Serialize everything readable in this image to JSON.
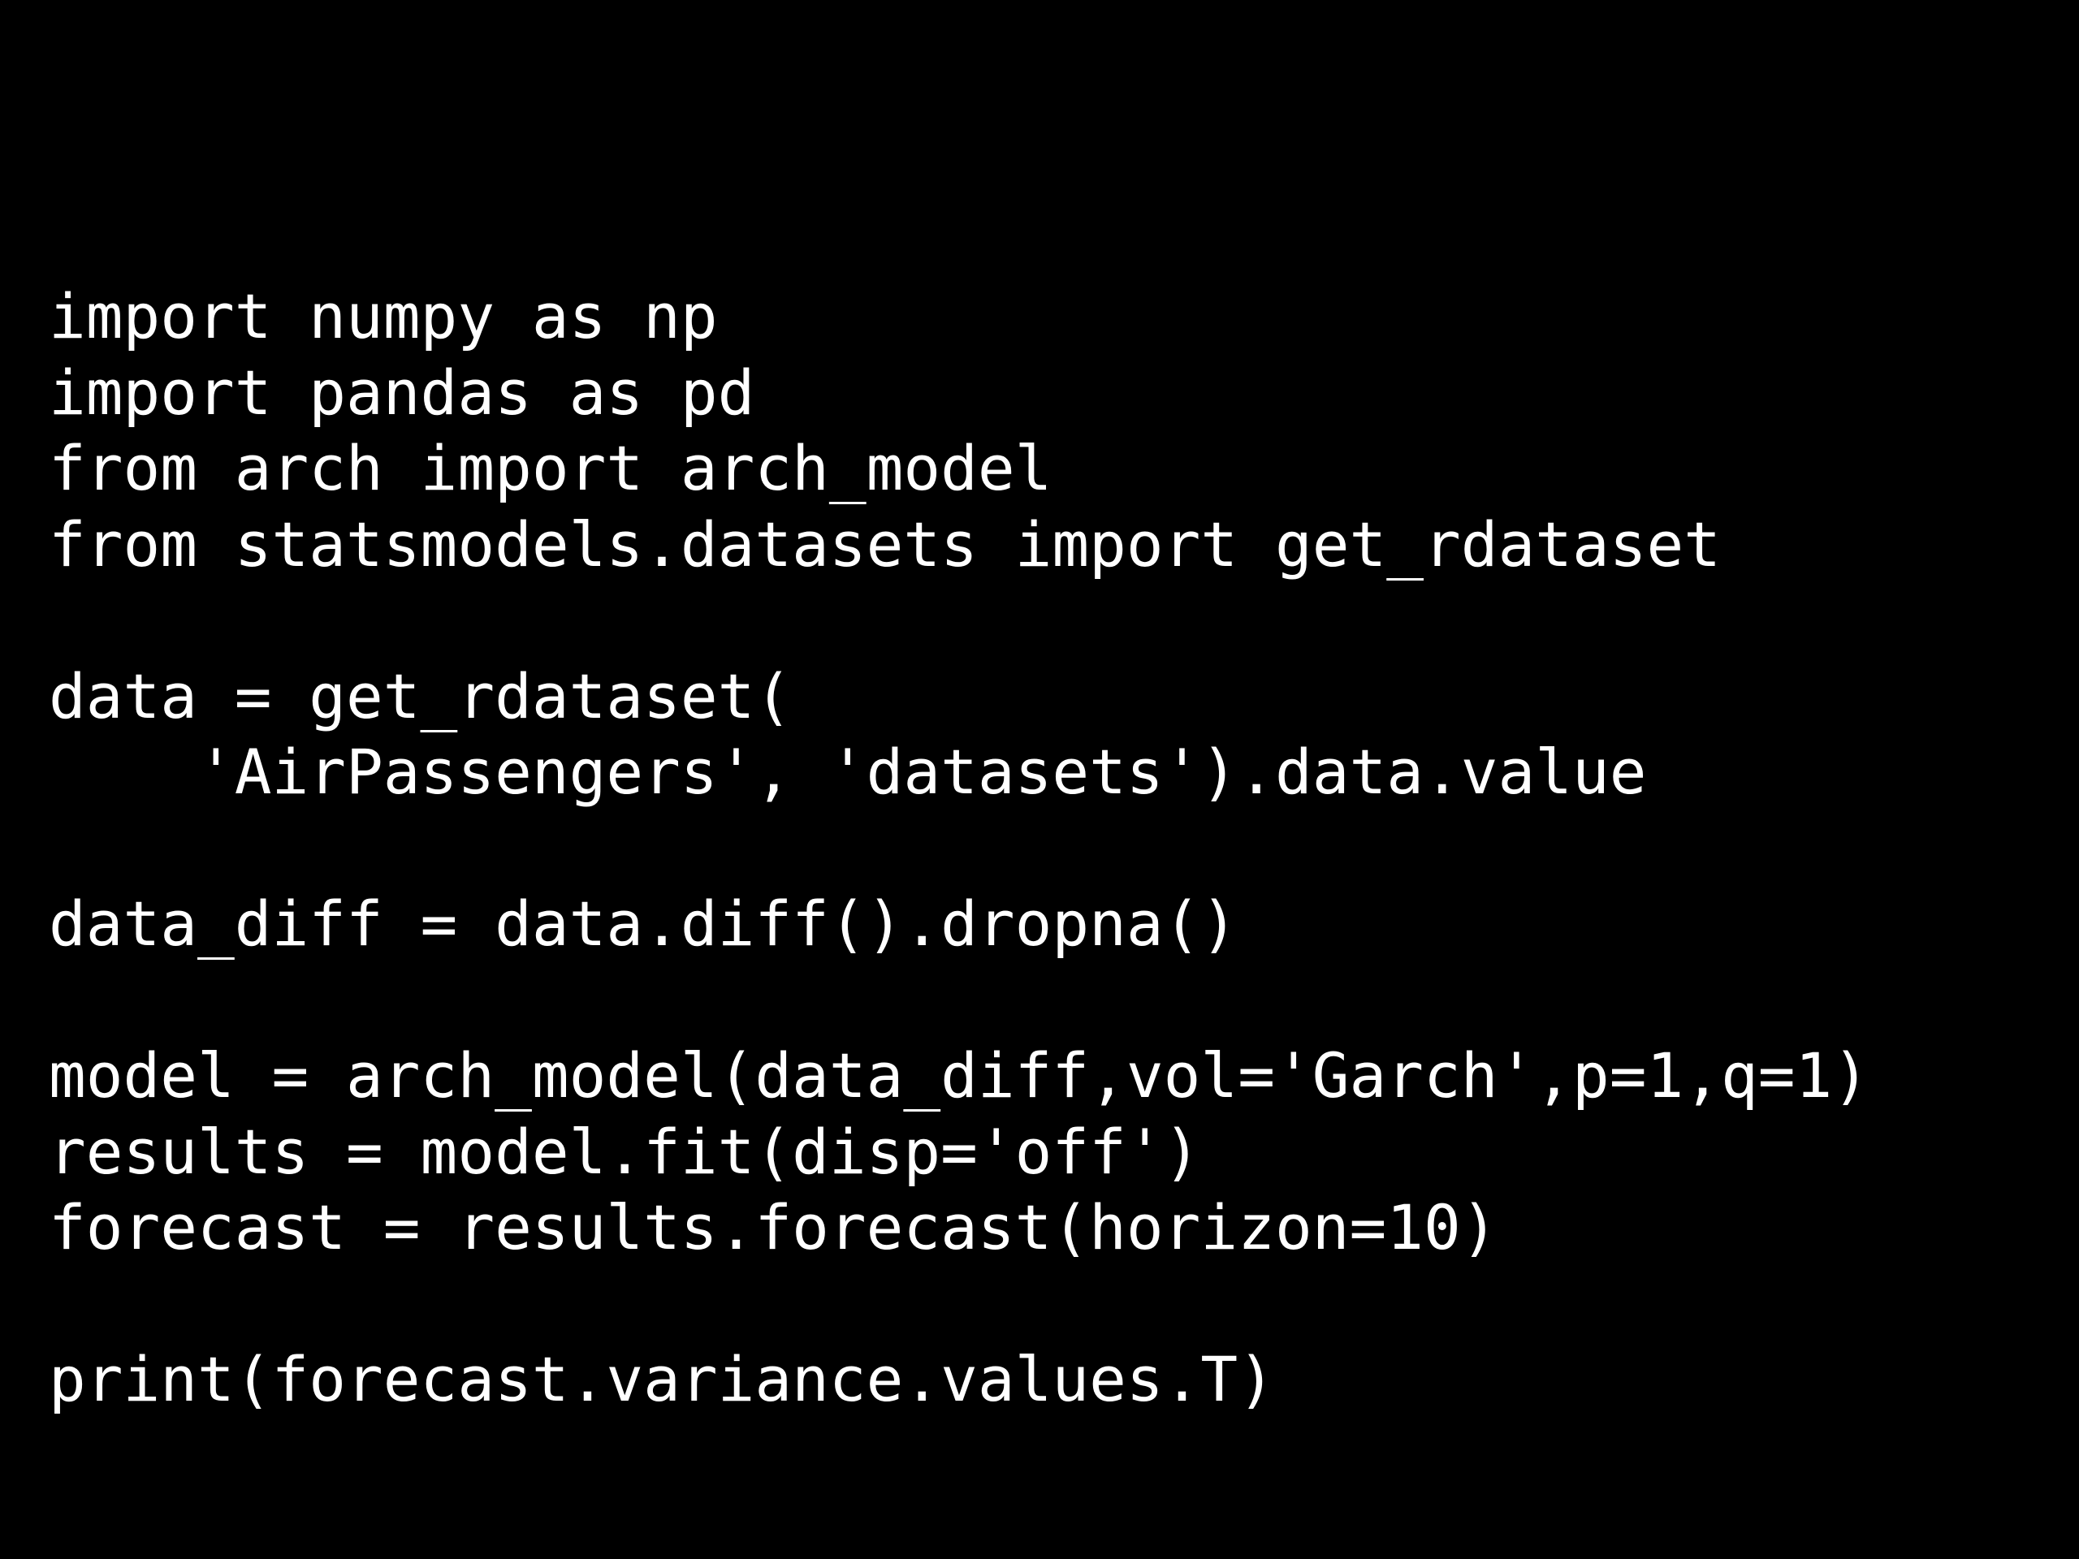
{
  "code": {
    "lines": [
      "import numpy as np",
      "import pandas as pd",
      "from arch import arch_model",
      "from statsmodels.datasets import get_rdataset",
      "",
      "data = get_rdataset(",
      "    'AirPassengers', 'datasets').data.value",
      "",
      "data_diff = data.diff().dropna()",
      "",
      "model = arch_model(data_diff,vol='Garch',p=1,q=1)",
      "results = model.fit(disp='off')",
      "forecast = results.forecast(horizon=10)",
      "",
      "print(forecast.variance.values.T)"
    ]
  },
  "colors": {
    "background": "#000000",
    "text": "#ffffff"
  }
}
